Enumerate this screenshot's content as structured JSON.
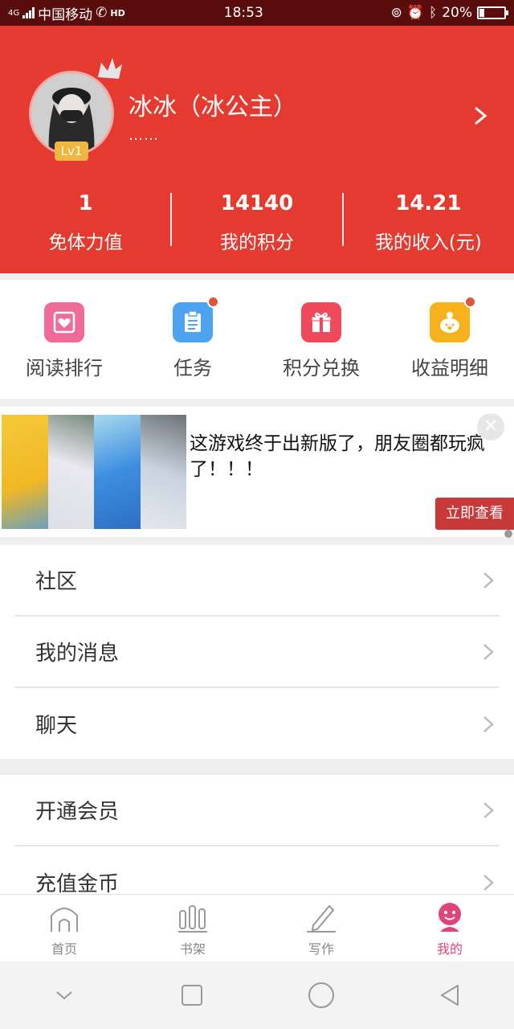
{
  "status_bar": {
    "network": "4G",
    "carrier": "中国移动",
    "hd": "HD",
    "time": "18:53",
    "battery": "20%"
  },
  "profile": {
    "name": "冰冰（冰公主）",
    "subtitle": "……",
    "level": "Lv1"
  },
  "stats": [
    {
      "value": "1",
      "label": "免体力值"
    },
    {
      "value": "14140",
      "label": "我的积分"
    },
    {
      "value": "14.21",
      "label": "我的收入(元)"
    }
  ],
  "quick_menu": [
    {
      "label": "阅读排行",
      "icon": "heart-book-icon",
      "color": "#f06b9a"
    },
    {
      "label": "任务",
      "icon": "clipboard-icon",
      "color": "#4da3f0"
    },
    {
      "label": "积分兑换",
      "icon": "gift-icon",
      "color": "#ee4a5c"
    },
    {
      "label": "收益明细",
      "icon": "piggy-bank-icon",
      "color": "#f5b21d"
    }
  ],
  "ad": {
    "text": "这游戏终于出新版了，朋友圈都玩疯了！！！",
    "button": "立即查看"
  },
  "menu_group_1": [
    {
      "label": "社区"
    },
    {
      "label": "我的消息"
    },
    {
      "label": "聊天"
    }
  ],
  "menu_group_2": [
    {
      "label": "开通会员"
    },
    {
      "label": "充值金币"
    }
  ],
  "tabs": [
    {
      "label": "首页",
      "icon": "home-icon"
    },
    {
      "label": "书架",
      "icon": "bookshelf-icon"
    },
    {
      "label": "写作",
      "icon": "pencil-icon"
    },
    {
      "label": "我的",
      "icon": "profile-icon",
      "active": true
    }
  ],
  "colors": {
    "header_red": "#e53a2f",
    "active_tab": "#e0457a",
    "badge_dot": "#e0553b"
  }
}
